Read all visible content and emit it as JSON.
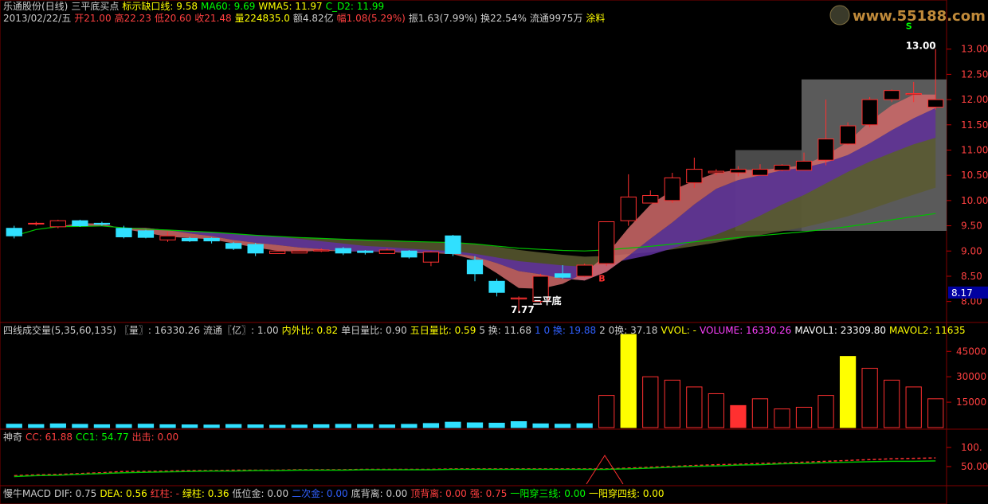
{
  "header": {
    "line1": [
      {
        "text": "乐通股份(日线)",
        "color": "#cccccc"
      },
      {
        "text": "三平底买点",
        "color": "#cccccc"
      },
      {
        "text": "标示缺口线: 9.58",
        "color": "#ffff00"
      },
      {
        "text": "MA60: 9.69",
        "color": "#00ff00"
      },
      {
        "text": "WMA5: 11.97",
        "color": "#ffff00"
      },
      {
        "text": "C_D2: 11.99",
        "color": "#00ff00"
      }
    ],
    "line2": [
      {
        "text": "2013/02/22/五",
        "color": "#cccccc"
      },
      {
        "text": "开21.00",
        "color": "#ff4040"
      },
      {
        "text": "高22.23",
        "color": "#ff4040"
      },
      {
        "text": "低20.60",
        "color": "#ff4040"
      },
      {
        "text": "收21.48",
        "color": "#ff4040"
      },
      {
        "text": "量224835.0",
        "color": "#ffff00"
      },
      {
        "text": "额4.82亿",
        "color": "#cccccc"
      },
      {
        "text": "幅1.08(5.29%)",
        "color": "#ff4040"
      },
      {
        "text": "振1.63(7.99%)",
        "color": "#cccccc"
      },
      {
        "text": "换22.54%",
        "color": "#cccccc"
      },
      {
        "text": "流通9975万",
        "color": "#cccccc"
      },
      {
        "text": "涂料",
        "color": "#ffff00"
      }
    ],
    "watermark": "www.55188.com"
  },
  "panels": {
    "volume_header": [
      {
        "text": "四线成交量(5,35,60,135)",
        "color": "#cccccc"
      },
      {
        "text": "〖量〗: 16330.26",
        "color": "#cccccc"
      },
      {
        "text": "流通〖亿〗: 1.00",
        "color": "#cccccc"
      },
      {
        "text": "内外比: 0.82",
        "color": "#ffff00"
      },
      {
        "text": "单日量比: 0.90",
        "color": "#cccccc"
      },
      {
        "text": "五日量比: 0.59",
        "color": "#ffff00"
      },
      {
        "text": "5 换: 11.68",
        "color": "#cccccc"
      },
      {
        "text": "1 0 换: 19.88",
        "color": "#3060ff"
      },
      {
        "text": "2 0换: 37.18",
        "color": "#cccccc"
      },
      {
        "text": "VVOL: -",
        "color": "#ffff00"
      },
      {
        "text": "VOLUME: 16330.26",
        "color": "#ff40ff"
      },
      {
        "text": "MAVOL1: 23309.80",
        "color": "#ffffff"
      },
      {
        "text": "MAVOL2: 11635",
        "color": "#ffff00"
      }
    ],
    "shenqi_header": [
      {
        "text": "神奇",
        "color": "#cccccc"
      },
      {
        "text": "CC: 61.88",
        "color": "#ff4040"
      },
      {
        "text": "CC1: 54.77",
        "color": "#00ff00"
      },
      {
        "text": "出击: 0.00",
        "color": "#ff4040"
      }
    ],
    "macd_header": [
      {
        "text": "慢牛MACD",
        "color": "#cccccc"
      },
      {
        "text": "DIF: 0.75",
        "color": "#cccccc"
      },
      {
        "text": "DEA: 0.56",
        "color": "#ffff00"
      },
      {
        "text": "红柱: -",
        "color": "#ff4040"
      },
      {
        "text": "绿柱: 0.36",
        "color": "#ffff00"
      },
      {
        "text": "低位金: 0.00",
        "color": "#cccccc"
      },
      {
        "text": "二次金: 0.00",
        "color": "#3060ff"
      },
      {
        "text": "底背离: 0.00",
        "color": "#cccccc"
      },
      {
        "text": "顶背离: 0.00",
        "color": "#ff4040"
      },
      {
        "text": "强: 0.75",
        "color": "#ff4040"
      },
      {
        "text": "一阳穿三线: 0.00",
        "color": "#00ff00"
      },
      {
        "text": "一阳穿四线: 0.00",
        "color": "#ffff00"
      }
    ]
  },
  "chart_data": [
    {
      "type": "candlestick",
      "ylim": [
        7.6,
        13.5
      ],
      "yticks": [
        "13.00",
        "12.50",
        "12.00",
        "11.50",
        "11.00",
        "10.50",
        "10.00",
        "9.50",
        "9.00",
        "8.50",
        "8.00"
      ],
      "current_price_label": "8.17",
      "annotations": [
        {
          "text": "13.00",
          "x_index": 41,
          "y": 13.0
        },
        {
          "text": "7.77",
          "x_index": 23,
          "y": 7.77
        },
        {
          "text": "三平底",
          "x_index": 24,
          "y": 7.95
        },
        {
          "text": "B",
          "x_index": 27,
          "y": 8.4
        },
        {
          "text": "S",
          "x_index": 41,
          "y": 13.4
        }
      ],
      "candles": [
        {
          "o": 9.45,
          "h": 9.5,
          "l": 9.25,
          "c": 9.3
        },
        {
          "o": 9.55,
          "h": 9.58,
          "l": 9.5,
          "c": 9.55
        },
        {
          "o": 9.48,
          "h": 9.62,
          "l": 9.45,
          "c": 9.6
        },
        {
          "o": 9.6,
          "h": 9.62,
          "l": 9.48,
          "c": 9.5
        },
        {
          "o": 9.55,
          "h": 9.58,
          "l": 9.5,
          "c": 9.53
        },
        {
          "o": 9.45,
          "h": 9.5,
          "l": 9.25,
          "c": 9.28
        },
        {
          "o": 9.4,
          "h": 9.42,
          "l": 9.25,
          "c": 9.27
        },
        {
          "o": 9.22,
          "h": 9.38,
          "l": 9.18,
          "c": 9.3
        },
        {
          "o": 9.25,
          "h": 9.28,
          "l": 9.18,
          "c": 9.2
        },
        {
          "o": 9.25,
          "h": 9.27,
          "l": 9.15,
          "c": 9.2
        },
        {
          "o": 9.15,
          "h": 9.18,
          "l": 9.02,
          "c": 9.05
        },
        {
          "o": 9.13,
          "h": 9.16,
          "l": 8.9,
          "c": 8.96
        },
        {
          "o": 8.95,
          "h": 9.0,
          "l": 8.95,
          "c": 9.0
        },
        {
          "o": 8.96,
          "h": 9.02,
          "l": 8.96,
          "c": 9.0
        },
        {
          "o": 9.0,
          "h": 9.05,
          "l": 8.98,
          "c": 9.02
        },
        {
          "o": 9.05,
          "h": 9.08,
          "l": 8.92,
          "c": 8.96
        },
        {
          "o": 9.0,
          "h": 9.02,
          "l": 8.93,
          "c": 8.97
        },
        {
          "o": 8.95,
          "h": 9.05,
          "l": 8.95,
          "c": 9.02
        },
        {
          "o": 9.0,
          "h": 9.02,
          "l": 8.85,
          "c": 8.88
        },
        {
          "o": 8.78,
          "h": 9.0,
          "l": 8.7,
          "c": 8.98
        },
        {
          "o": 9.3,
          "h": 9.32,
          "l": 8.9,
          "c": 8.95
        },
        {
          "o": 8.82,
          "h": 8.9,
          "l": 8.4,
          "c": 8.55
        },
        {
          "o": 8.4,
          "h": 8.45,
          "l": 8.1,
          "c": 8.18
        },
        {
          "o": 8.05,
          "h": 8.1,
          "l": 7.77,
          "c": 8.07
        },
        {
          "o": 8.0,
          "h": 8.55,
          "l": 7.95,
          "c": 8.5
        },
        {
          "o": 8.55,
          "h": 8.72,
          "l": 8.45,
          "c": 8.48
        },
        {
          "o": 8.5,
          "h": 8.75,
          "l": 8.48,
          "c": 8.72
        },
        {
          "o": 8.75,
          "h": 9.58,
          "l": 8.7,
          "c": 9.58
        },
        {
          "o": 9.6,
          "h": 10.52,
          "l": 9.5,
          "c": 10.07
        },
        {
          "o": 9.95,
          "h": 10.2,
          "l": 9.95,
          "c": 10.1
        },
        {
          "o": 10.0,
          "h": 10.55,
          "l": 9.95,
          "c": 10.45
        },
        {
          "o": 10.35,
          "h": 10.85,
          "l": 10.25,
          "c": 10.62
        },
        {
          "o": 10.55,
          "h": 10.62,
          "l": 10.5,
          "c": 10.58
        },
        {
          "o": 10.55,
          "h": 10.68,
          "l": 10.48,
          "c": 10.62
        },
        {
          "o": 10.5,
          "h": 10.72,
          "l": 10.5,
          "c": 10.62
        },
        {
          "o": 10.6,
          "h": 10.72,
          "l": 10.58,
          "c": 10.7
        },
        {
          "o": 10.6,
          "h": 10.95,
          "l": 10.6,
          "c": 10.78
        },
        {
          "o": 10.8,
          "h": 12.0,
          "l": 10.7,
          "c": 11.22
        },
        {
          "o": 11.12,
          "h": 11.55,
          "l": 11.1,
          "c": 11.48
        },
        {
          "o": 11.5,
          "h": 12.05,
          "l": 11.45,
          "c": 12.0
        },
        {
          "o": 12.0,
          "h": 12.2,
          "l": 11.95,
          "c": 12.18
        },
        {
          "o": 12.1,
          "h": 12.35,
          "l": 11.95,
          "c": 12.12
        },
        {
          "o": 11.85,
          "h": 13.0,
          "l": 11.8,
          "c": 12.0
        }
      ]
    },
    {
      "type": "bar",
      "ylim": [
        0,
        55000
      ],
      "yticks": [
        "45000",
        "30000",
        "15000"
      ],
      "values": [
        2000,
        1800,
        2200,
        1900,
        1700,
        1800,
        2000,
        1700,
        1600,
        1500,
        1800,
        1600,
        1400,
        1500,
        1700,
        1900,
        1800,
        1600,
        1900,
        2400,
        3200,
        2800,
        2600,
        3500,
        2200,
        2000,
        2300,
        19000,
        55000,
        30000,
        28000,
        24000,
        20000,
        13000,
        17000,
        11000,
        12000,
        19000,
        42000,
        35000,
        28000,
        24000,
        17000
      ]
    },
    {
      "type": "line",
      "yticks": [
        "100.",
        "50.00"
      ],
      "series": [
        {
          "name": "CC",
          "values": [
            20,
            22,
            23,
            25,
            27,
            30,
            30,
            31,
            32,
            32,
            33,
            33,
            33,
            34,
            34,
            34,
            35,
            35,
            35,
            35,
            36,
            36,
            36,
            36,
            36,
            36,
            36,
            36,
            38,
            40,
            42,
            44,
            46,
            47,
            49,
            50,
            52,
            54,
            56,
            58,
            60,
            61,
            62
          ]
        },
        {
          "name": "CC1",
          "values": [
            18,
            20,
            21,
            23,
            25,
            27,
            28,
            29,
            30,
            31,
            31,
            32,
            32,
            33,
            33,
            33,
            34,
            34,
            34,
            34,
            35,
            35,
            35,
            35,
            35,
            35,
            35,
            35,
            36,
            38,
            40,
            42,
            43,
            45,
            46,
            48,
            49,
            51,
            52,
            53,
            54,
            54,
            55
          ]
        }
      ]
    }
  ]
}
